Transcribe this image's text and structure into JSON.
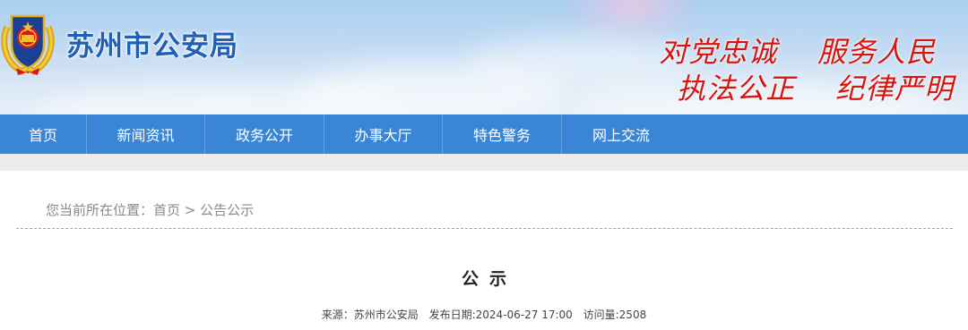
{
  "header": {
    "site_title": "苏州市公安局",
    "slogan_line1": "对党忠诚    服务人民",
    "slogan_line2": "执法公正    纪律严明",
    "emblem_icon": "police-emblem-icon",
    "title_color": "#1f5fb5",
    "slogan_color": "#d8140f"
  },
  "nav": {
    "bar_color": "#3a85d6",
    "items": [
      {
        "label": "首页"
      },
      {
        "label": "新闻资讯"
      },
      {
        "label": "政务公开"
      },
      {
        "label": "办事大厅"
      },
      {
        "label": "特色警务"
      },
      {
        "label": "网上交流"
      }
    ]
  },
  "breadcrumb": {
    "prefix": "您当前所在位置：",
    "home": "首页",
    "separator": " > ",
    "current": "公告公示"
  },
  "article": {
    "title": "公示",
    "source_label": "来源：苏州市公安局",
    "date_label": "发布日期:2024-06-27 17:00",
    "views_label": "访问量:2508"
  }
}
